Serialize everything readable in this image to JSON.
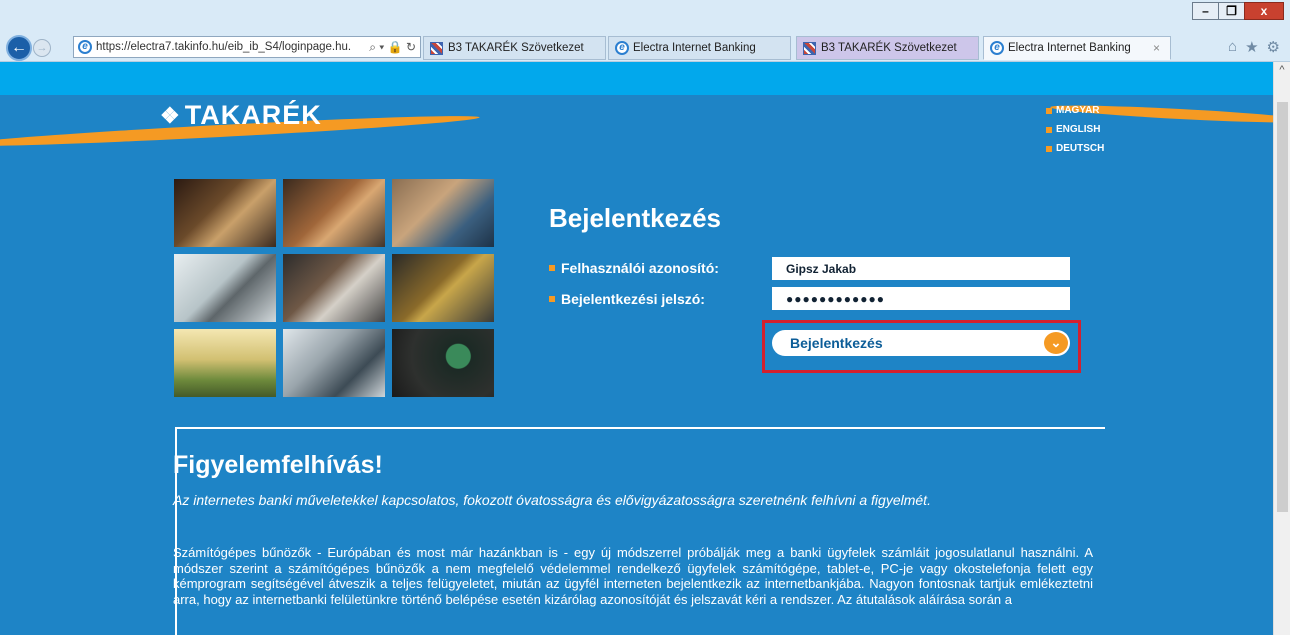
{
  "browser": {
    "window_controls": {
      "minimize": "–",
      "restore": "❐",
      "close": "x"
    },
    "back_glyph": "←",
    "forward_glyph": "→",
    "address": {
      "url": "https://electra7.takinfo.hu/eib_ib_S4/loginpage.hu.",
      "tools": "⌕ ▾ 🔒 ↻"
    },
    "tabs": [
      {
        "label": "B3 TAKARÉK Szövetkezet"
      },
      {
        "label": "Electra Internet Banking"
      },
      {
        "label": "B3 TAKARÉK Szövetkezet"
      },
      {
        "label": "Electra Internet Banking",
        "close": "×"
      }
    ],
    "right_icons": {
      "home": "⌂",
      "favorites": "★",
      "settings": "⚙"
    },
    "scroll_up": "^"
  },
  "site": {
    "logo": {
      "mark": "❖",
      "text": "TAKARÉK"
    },
    "languages": [
      "MAGYAR",
      "ENGLISH",
      "DEUTSCH"
    ],
    "login": {
      "title": "Bejelentkezés",
      "username_label": "Felhasználói azonosító:",
      "username_value": "Gipsz Jakab",
      "password_label": "Bejelentkezési jelszó:",
      "password_value": "●●●●●●●●●●●●",
      "button_label": "Bejelentkezés",
      "button_icon": "⌄"
    },
    "notice": {
      "title": "Figyelemfelhívás!",
      "subtitle": "Az internetes banki műveletekkel kapcsolatos, fokozott óvatosságra és elővigyázatosságra szeretnénk felhívni a figyelmét.",
      "body": "Számítógépes bűnözők - Európában és most már hazánkban is - egy új módszerrel próbálják meg a banki ügyfelek számláit jogosulatlanul használni. A módszer szerint a számítógépes bűnözők a nem megfelelő védelemmel rendelkező ügyfelek számítógépe, tablet-e, PC-je vagy okostelefonja felett egy kémprogram segítségével átveszik a teljes felügyeletet, miután az ügyfél interneten bejelentkezik az internetbankjába. Nagyon fontosnak tartjuk emlékeztetni arra, hogy az internetbanki felületünkre történő belépése esetén kizárólag azonosítóját és jelszavát kéri a rendszer. Az átutalások aláírása során a"
    }
  },
  "colors": {
    "brand_blue": "#1e84c6",
    "accent_orange": "#f59a23",
    "highlight_red": "#d3202e",
    "top_band": "#02a8ec"
  }
}
